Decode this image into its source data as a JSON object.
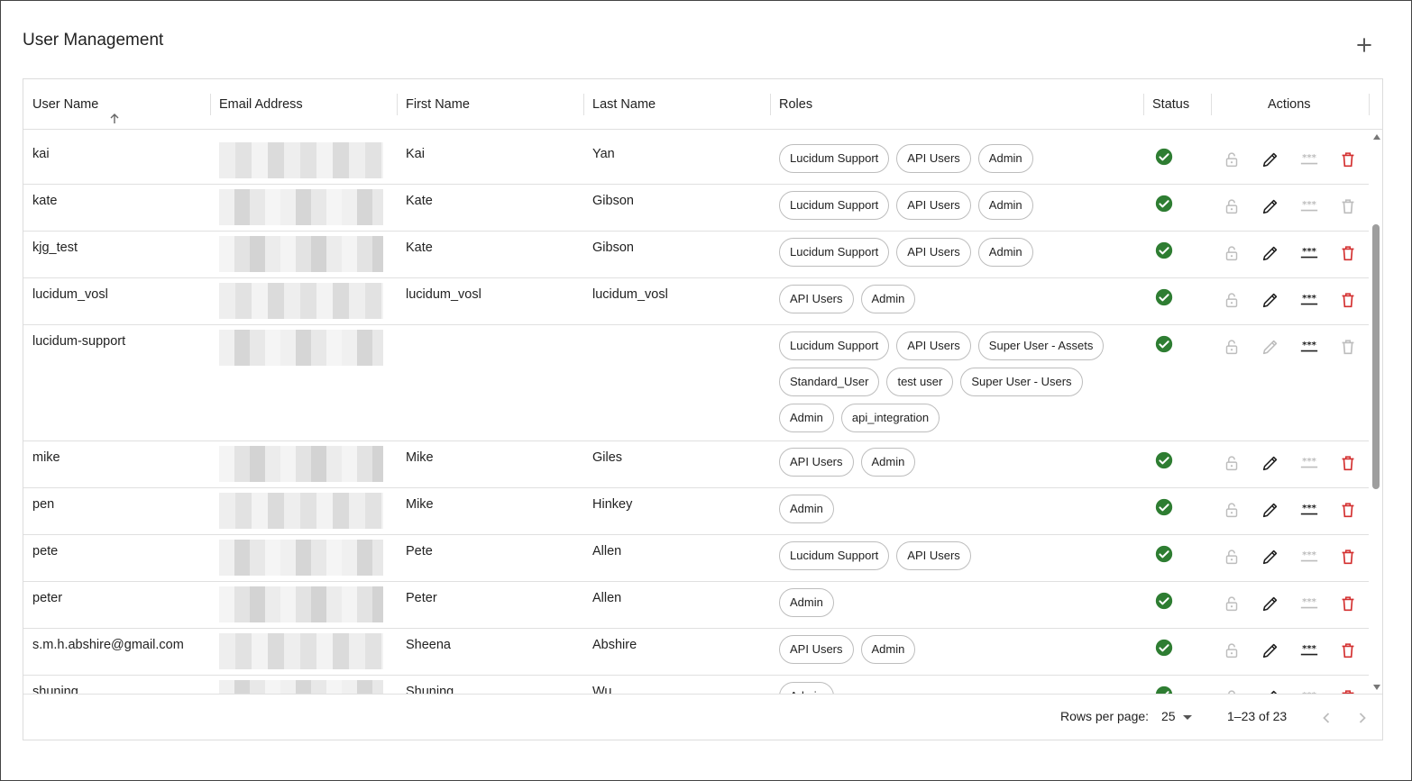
{
  "page": {
    "title": "User Management",
    "add_icon": "plus-icon"
  },
  "columns": {
    "user_name": "User Name",
    "email": "Email Address",
    "first_name": "First Name",
    "last_name": "Last Name",
    "roles": "Roles",
    "status": "Status",
    "actions": "Actions"
  },
  "rows": [
    {
      "user": "kai",
      "email": "",
      "first": "Kai",
      "last": "Yan",
      "roles": [
        "Lucidum Support",
        "API Users",
        "Admin"
      ],
      "status": "active",
      "lock": "disabled",
      "edit": "enabled",
      "password": "disabled",
      "delete": "enabled"
    },
    {
      "user": "kate",
      "email": "",
      "first": "Kate",
      "last": "Gibson",
      "roles": [
        "Lucidum Support",
        "API Users",
        "Admin"
      ],
      "status": "active",
      "lock": "disabled",
      "edit": "enabled",
      "password": "disabled",
      "delete": "disabled"
    },
    {
      "user": "kjg_test",
      "email": "",
      "first": "Kate",
      "last": "Gibson",
      "roles": [
        "Lucidum Support",
        "API Users",
        "Admin"
      ],
      "status": "active",
      "lock": "disabled",
      "edit": "enabled",
      "password": "enabled",
      "delete": "enabled"
    },
    {
      "user": "lucidum_vosl",
      "email": "",
      "first": "lucidum_vosl",
      "last": "lucidum_vosl",
      "roles": [
        "API Users",
        "Admin"
      ],
      "status": "active",
      "lock": "disabled",
      "edit": "enabled",
      "password": "enabled",
      "delete": "enabled"
    },
    {
      "user": "lucidum-support",
      "email": "",
      "first": "",
      "last": "",
      "roles": [
        "Lucidum Support",
        "API Users",
        "Super User - Assets",
        "Standard_User",
        "test user",
        "Super User - Users",
        "Admin",
        "api_integration"
      ],
      "status": "active",
      "lock": "disabled",
      "edit": "disabled",
      "password": "enabled",
      "delete": "disabled"
    },
    {
      "user": "mike",
      "email": "",
      "first": "Mike",
      "last": "Giles",
      "roles": [
        "API Users",
        "Admin"
      ],
      "status": "active",
      "lock": "disabled",
      "edit": "enabled",
      "password": "disabled",
      "delete": "enabled"
    },
    {
      "user": "pen",
      "email": "",
      "first": "Mike",
      "last": "Hinkey",
      "roles": [
        "Admin"
      ],
      "status": "active",
      "lock": "disabled",
      "edit": "enabled",
      "password": "enabled",
      "delete": "enabled"
    },
    {
      "user": "pete",
      "email": "",
      "first": "Pete",
      "last": "Allen",
      "roles": [
        "Lucidum Support",
        "API Users"
      ],
      "status": "active",
      "lock": "disabled",
      "edit": "enabled",
      "password": "disabled",
      "delete": "enabled"
    },
    {
      "user": "peter",
      "email": "",
      "first": "Peter",
      "last": "Allen",
      "roles": [
        "Admin"
      ],
      "status": "active",
      "lock": "disabled",
      "edit": "enabled",
      "password": "disabled",
      "delete": "enabled"
    },
    {
      "user": "s.m.h.abshire@gmail.com",
      "email": "",
      "first": "Sheena",
      "last": "Abshire",
      "roles": [
        "API Users",
        "Admin"
      ],
      "status": "active",
      "lock": "disabled",
      "edit": "enabled",
      "password": "enabled",
      "delete": "enabled"
    },
    {
      "user": "shuning",
      "email": "",
      "first": "Shuning",
      "last": "Wu",
      "roles": [
        "Admin"
      ],
      "status": "active",
      "lock": "disabled",
      "edit": "enabled",
      "password": "disabled",
      "delete": "enabled"
    }
  ],
  "footer": {
    "rows_per_page_label": "Rows per page:",
    "rows_per_page_value": "25",
    "range": "1–23 of 23"
  },
  "colors": {
    "status_ok": "#2e7d32",
    "delete_red": "#d32f2f",
    "icon_dark": "#212121",
    "icon_disabled": "#bdbdbd"
  }
}
